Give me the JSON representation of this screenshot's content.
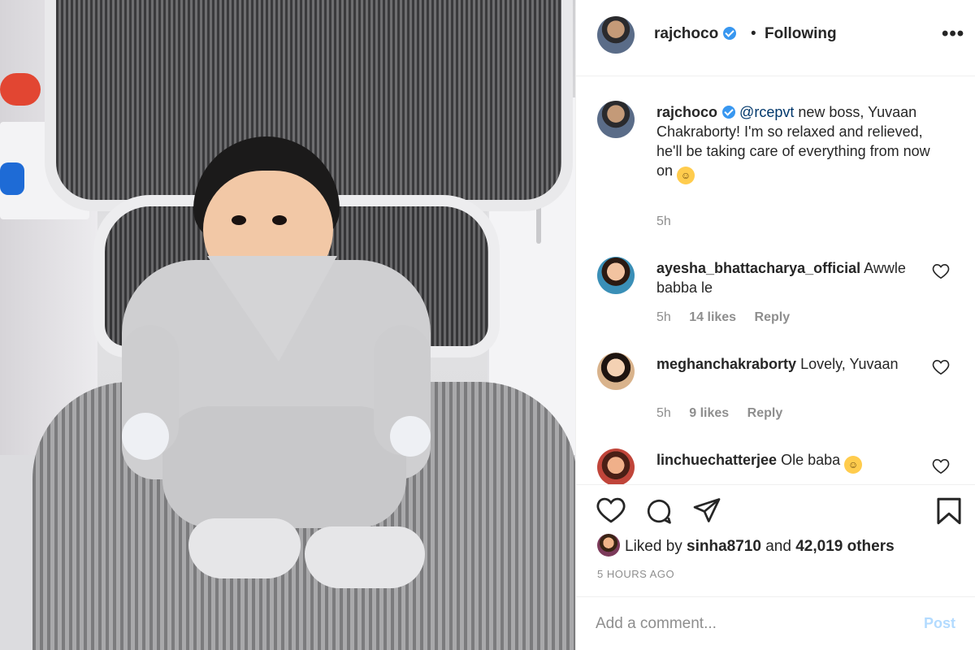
{
  "post": {
    "username": "rajchoco",
    "follow_separator": "•",
    "follow_status": "Following",
    "more_icon": "more-icon"
  },
  "caption": {
    "username": "rajchoco",
    "mention": "@rcepvt",
    "text": " new boss, Yuvaan Chakraborty! I'm so relaxed and relieved, he'll be taking care of everything from now on ",
    "emoji": "😌",
    "time": "5h"
  },
  "comments": [
    {
      "username": "ayesha_bhattacharya_official",
      "text": "Awwle babba le",
      "time": "5h",
      "likes": "14 likes",
      "reply": "Reply",
      "avatar_color": "#3a8fb7"
    },
    {
      "username": "meghanchakraborty",
      "text": "Lovely, Yuvaan",
      "time": "5h",
      "likes": "9 likes",
      "reply": "Reply",
      "avatar_color": "#d9b38c"
    },
    {
      "username": "linchuechatterjee",
      "text": "Ole baba ",
      "emoji": "🤗",
      "avatar_color": "#c0453a"
    }
  ],
  "likes": {
    "prefix": "Liked by ",
    "user": "sinha8710",
    "middle": " and ",
    "count": "42,019 others"
  },
  "timestamp": "5 HOURS AGO",
  "add_comment": {
    "placeholder": "Add a comment...",
    "post_label": "Post"
  },
  "colors": {
    "link": "#00376b",
    "verified": "#3897f0",
    "muted": "#8e8e8e",
    "post_disabled": "#b3dbff"
  }
}
